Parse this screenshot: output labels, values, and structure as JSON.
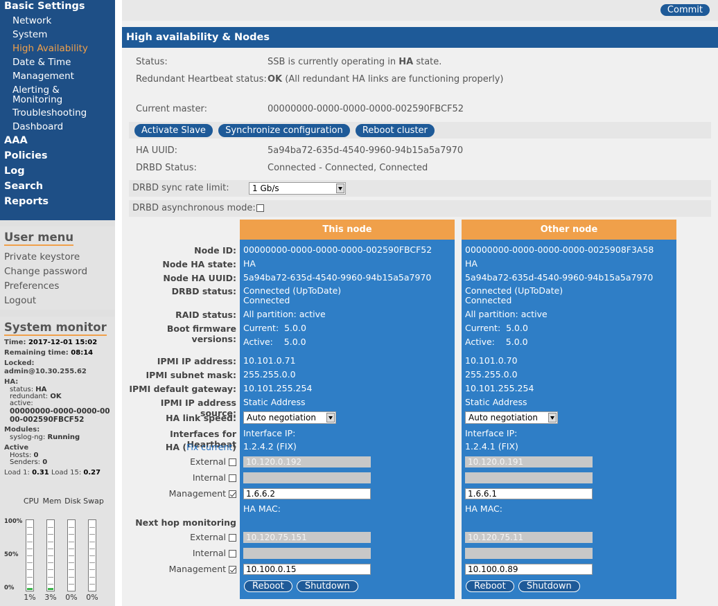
{
  "sidebar": {
    "basic_settings": "Basic Settings",
    "items": [
      "Network",
      "System",
      "High Availability",
      "Date & Time",
      "Management"
    ],
    "alerting1": "Alerting &",
    "alerting2": "Monitoring",
    "items2": [
      "Troubleshooting",
      "Dashboard"
    ],
    "sections": [
      "AAA",
      "Policies",
      "Log",
      "Search",
      "Reports"
    ]
  },
  "usermenu": {
    "title": "User menu",
    "items": [
      "Private keystore",
      "Change password",
      "Preferences",
      "Logout"
    ]
  },
  "sysmon": {
    "title": "System monitor",
    "time_label": "Time:",
    "time": "2017-12-01 15:02",
    "remaining_label": "Remaining time:",
    "remaining": "08:14",
    "locked_label": "Locked:",
    "locked": "admin@10.30.255.62",
    "ha_label": "HA:",
    "status_label": "status:",
    "status": "HA",
    "redundant_label": "redundant:",
    "redundant": "OK",
    "active_label": "active:",
    "active1": "00000000-0000-0000-00",
    "active2": "00-002590FBCF52",
    "modules_label": "Modules:",
    "module_name": "syslog-ng:",
    "module_status": "Running",
    "active2_label": "Active",
    "hosts_label": "Hosts:",
    "hosts": "0",
    "senders_label": "Senders:",
    "senders": "0",
    "load1_label": "Load 1:",
    "load1": "0.31",
    "load15_label": "Load 15:",
    "load15": "0.27",
    "gauge_heads": [
      "CPU",
      "Mem",
      "Disk",
      "Swap"
    ],
    "gauge_ticks": [
      "100%",
      "50%",
      "0%"
    ],
    "gauge_values": [
      "1%",
      "3%",
      "0%",
      "0%"
    ],
    "gauge_fill": [
      0.01,
      0.03,
      0,
      0
    ]
  },
  "main": {
    "commit": "Commit",
    "title": "High availability & Nodes",
    "status_label": "Status:",
    "status_pre": "SSB is currently operating in ",
    "status_bold": "HA",
    "status_post": " state.",
    "rh_label": "Redundant Heartbeat status:",
    "rh_bold": "OK",
    "rh_rest": " (All redundant HA links are functioning properly)",
    "cm_label": "Current master:",
    "cm_value": "00000000-0000-0000-0000-002590FBCF52",
    "btn_activate": "Activate Slave",
    "btn_sync": "Synchronize configuration",
    "btn_reboot_cluster": "Reboot cluster",
    "uuid_label": "HA UUID:",
    "uuid_value": "5a94ba72-635d-4540-9960-94b15a5a7970",
    "drbd_label": "DRBD Status:",
    "drbd_value": "Connected - Connected, Connected",
    "sync_label": "DRBD sync rate limit:",
    "sync_value": "1 Gb/s",
    "async_label": "DRBD asynchronous mode:"
  },
  "labels": {
    "node_id": "Node ID:",
    "node_ha_state": "Node HA state:",
    "node_ha_uuid": "Node HA UUID:",
    "drbd_status": "DRBD status:",
    "raid_status": "RAID status:",
    "boot_fw": "Boot firmware versions:",
    "ipmi_ip": "IPMI IP address:",
    "ipmi_mask": "IPMI subnet mask:",
    "ipmi_gw": "IPMI default gateway:",
    "ipmi_src": "IPMI IP address source:",
    "ha_link": "HA link speed:",
    "ifaces1": "Interfaces for Heartbeat",
    "ifaces2_pre": "HA (",
    "fix_current": "Fix current",
    "ifaces2_post": ")",
    "external": "External",
    "internal": "Internal",
    "management": "Management",
    "next_hop": "Next hop monitoring"
  },
  "nodes": [
    {
      "title": "This node",
      "node_id": "00000000-0000-0000-0000-002590FBCF52",
      "ha_state": "HA",
      "ha_uuid": "5a94ba72-635d-4540-9960-94b15a5a7970",
      "drbd1": "Connected (UpToDate)",
      "drbd2": "Connected",
      "raid": "All partition: active",
      "fw_current": "Current:  5.0.0",
      "fw_active": "Active:    5.0.0",
      "ipmi_ip": "10.101.0.71",
      "ipmi_mask": "255.255.0.0",
      "ipmi_gw": "10.101.255.254",
      "ipmi_src": "Static Address",
      "link_speed": "Auto negotiation",
      "iface_ip_label": "Interface IP:",
      "iface_ip": "1.2.4.2 (FIX)",
      "hb_external": "10.120.0.192",
      "hb_internal": "",
      "hb_mgmt": "1.6.6.2",
      "ha_mac": "HA MAC:",
      "nh_external": "10.120.75.151",
      "nh_internal": "",
      "nh_mgmt": "10.100.0.15",
      "reboot": "Reboot",
      "shutdown": "Shutdown"
    },
    {
      "title": "Other node",
      "node_id": "00000000-0000-0000-0000-0025908F3A58",
      "ha_state": "HA",
      "ha_uuid": "5a94ba72-635d-4540-9960-94b15a5a7970",
      "drbd1": "Connected (UpToDate)",
      "drbd2": "Connected",
      "raid": "All partition: active",
      "fw_current": "Current:  5.0.0",
      "fw_active": "Active:    5.0.0",
      "ipmi_ip": "10.101.0.70",
      "ipmi_mask": "255.255.0.0",
      "ipmi_gw": "10.101.255.254",
      "ipmi_src": "Static Address",
      "link_speed": "Auto negotiation",
      "iface_ip_label": "Interface IP:",
      "iface_ip": "1.2.4.1 (FIX)",
      "hb_external": "10.120.0.191",
      "hb_internal": "",
      "hb_mgmt": "1.6.6.1",
      "ha_mac": "HA MAC:",
      "nh_external": "10.120.75.11",
      "nh_internal": "",
      "nh_mgmt": "10.100.0.89",
      "reboot": "Reboot",
      "shutdown": "Shutdown"
    }
  ]
}
